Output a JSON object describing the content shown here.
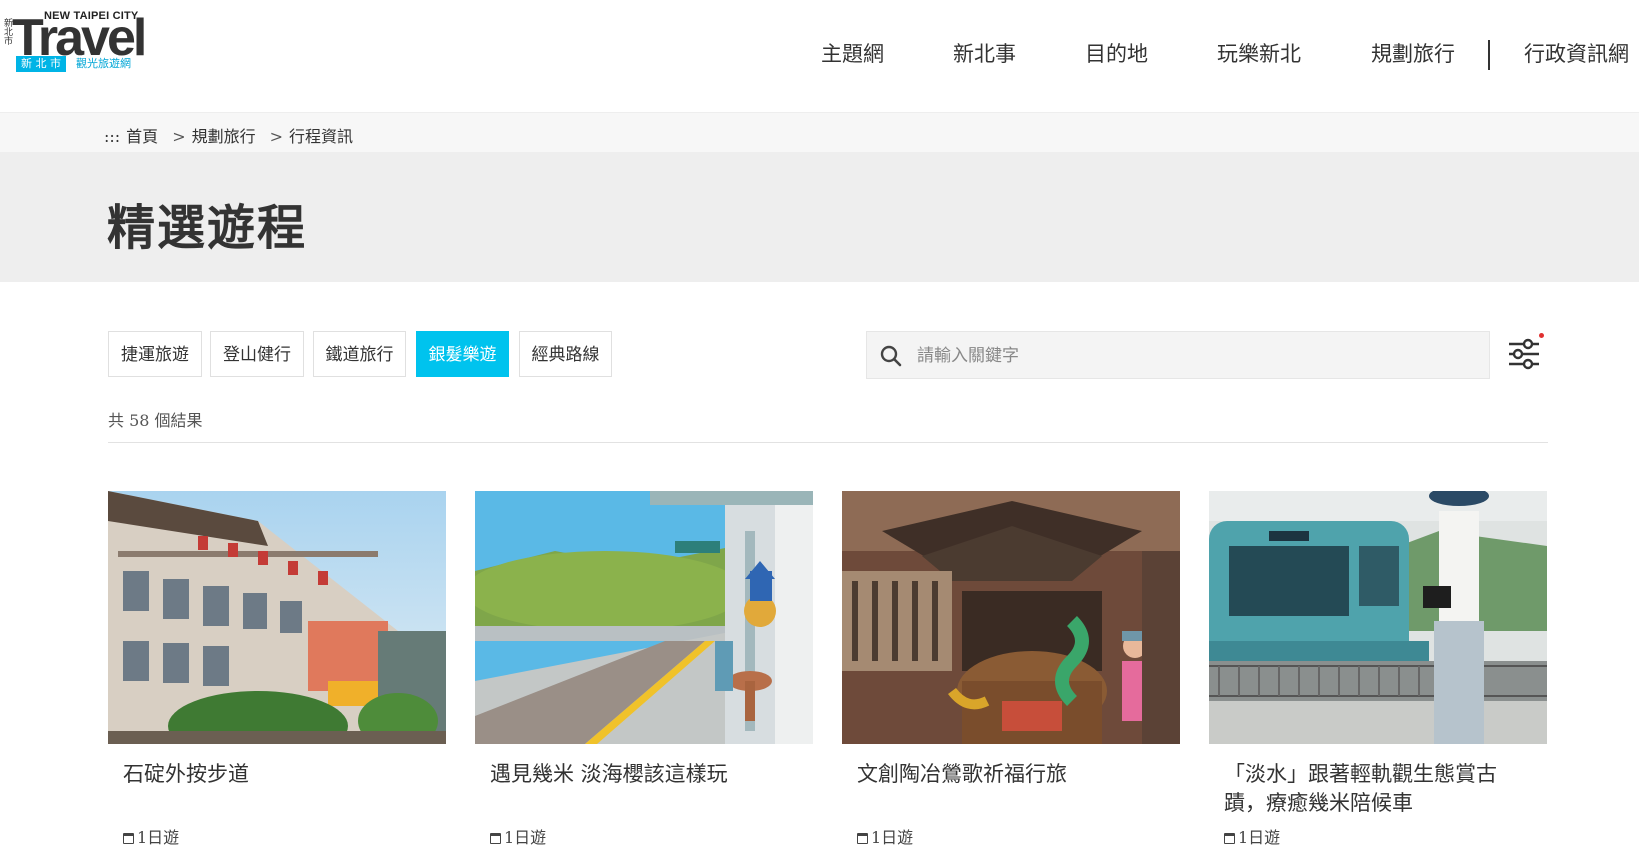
{
  "logo": {
    "side_text": "新北市",
    "city": "NEW TAIPEI CITY",
    "word": "Travel",
    "tag_left": "新 北 市",
    "tag_right": "觀光旅遊網"
  },
  "nav": {
    "items": [
      "主題網",
      "新北事",
      "目的地",
      "玩樂新北",
      "規劃旅行",
      "行政資訊網"
    ]
  },
  "breadcrumb": {
    "marker": ":::",
    "items": [
      "首頁",
      "規劃旅行",
      "行程資訊"
    ],
    "separator": ">"
  },
  "page_title": "精選遊程",
  "filters": {
    "tags": [
      "捷運旅遊",
      "登山健行",
      "鐵道旅行",
      "銀髮樂遊",
      "經典路線"
    ],
    "active": "銀髮樂遊"
  },
  "search": {
    "placeholder": "請輸入關鍵字"
  },
  "result_count": "共 58 個結果",
  "cards": [
    {
      "title": "石碇外按步道",
      "duration": "1日遊"
    },
    {
      "title": "遇見幾米 淡海櫻該這樣玩",
      "duration": "1日遊"
    },
    {
      "title": "文創陶冶鶯歌祈福行旅",
      "duration": "1日遊"
    },
    {
      "title": "「淡水」跟著輕軌觀生態賞古蹟，療癒幾米陪候車",
      "duration": "1日遊"
    }
  ],
  "colors": {
    "accent": "#00c3ee",
    "banner_bg": "#eeeeee",
    "text": "#333333"
  }
}
